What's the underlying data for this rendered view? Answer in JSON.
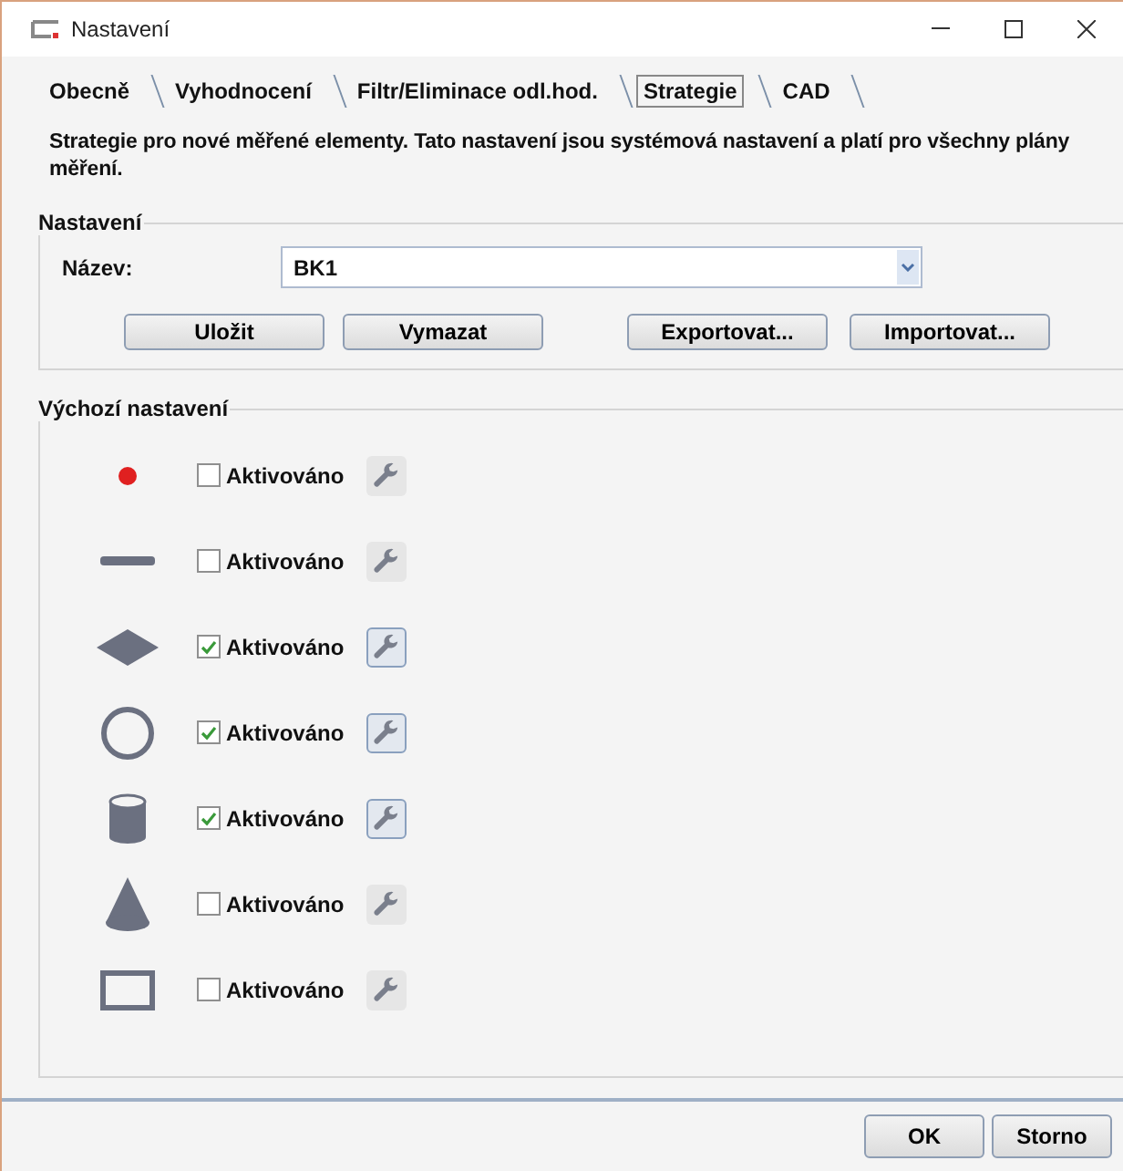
{
  "window": {
    "title": "Nastavení"
  },
  "tabs": [
    {
      "label": "Obecně",
      "selected": false
    },
    {
      "label": "Vyhodnocení",
      "selected": false
    },
    {
      "label": "Filtr/Eliminace odl.hod.",
      "selected": false
    },
    {
      "label": "Strategie",
      "selected": true
    },
    {
      "label": "CAD",
      "selected": false
    }
  ],
  "description": "Strategie pro nové měřené elementy. Tato nastavení jsou systémová nastavení a platí pro všechny plány měření.",
  "settings_group": {
    "title": "Nastavení",
    "name_label": "Název:",
    "name_value": "BK1",
    "buttons": [
      "Uložit",
      "Vymazat",
      "Exportovat...",
      "Importovat..."
    ]
  },
  "defaults_group": {
    "title": "Výchozí nastavení",
    "items": [
      {
        "kind": "point",
        "label": "Aktivováno",
        "checked": false
      },
      {
        "kind": "line",
        "label": "Aktivováno",
        "checked": false
      },
      {
        "kind": "plane",
        "label": "Aktivováno",
        "checked": true
      },
      {
        "kind": "circle",
        "label": "Aktivováno",
        "checked": true
      },
      {
        "kind": "cylinder",
        "label": "Aktivováno",
        "checked": true
      },
      {
        "kind": "cone",
        "label": "Aktivováno",
        "checked": false
      },
      {
        "kind": "rectangle",
        "label": "Aktivováno",
        "checked": false
      }
    ]
  },
  "buttons": [
    "OK",
    "Storno"
  ]
}
